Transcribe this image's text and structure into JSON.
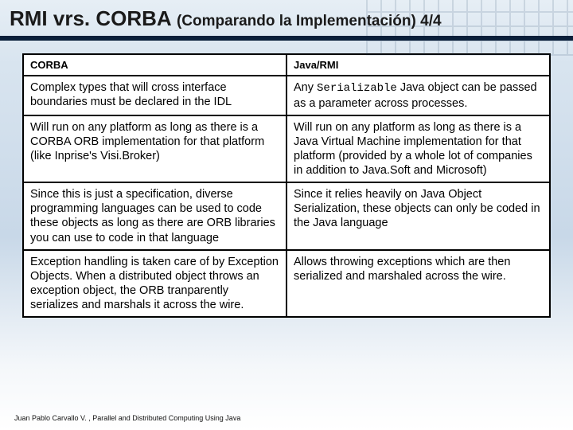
{
  "title": {
    "main": "RMI vrs. CORBA ",
    "sub": "(Comparando la Implementación) 4/4"
  },
  "table": {
    "headers": {
      "left": "CORBA",
      "right": "Java/RMI"
    },
    "rows": [
      {
        "left": "Complex types that will cross interface boundaries must be declared in the IDL",
        "right_pre": "Any ",
        "right_code": "Serializable",
        "right_post": " Java object can be passed as a parameter across processes."
      },
      {
        "left": "Will run on any platform as long as there is a CORBA ORB implementation for that platform (like Inprise's Visi.Broker)",
        "right": "Will run on any platform as long as there is a Java Virtual Machine implementation for that platform (provided by a whole lot of companies in addition to Java.Soft and Microsoft)"
      },
      {
        "left": "Since this is just a specification, diverse programming languages can be used to code these objects as long as there are ORB libraries you can use to code in that language",
        "right": "Since it relies heavily on Java Object Serialization, these objects can only be coded in the Java language"
      },
      {
        "left": "Exception handling is taken care of by Exception Objects. When a distributed object throws an exception object, the ORB tranparently serializes and marshals it across the wire.",
        "right": "Allows throwing exceptions which are then serialized and marshaled across the wire."
      }
    ]
  },
  "footer": "Juan Pablo Carvallo V. , Parallel and Distributed Computing Using Java"
}
